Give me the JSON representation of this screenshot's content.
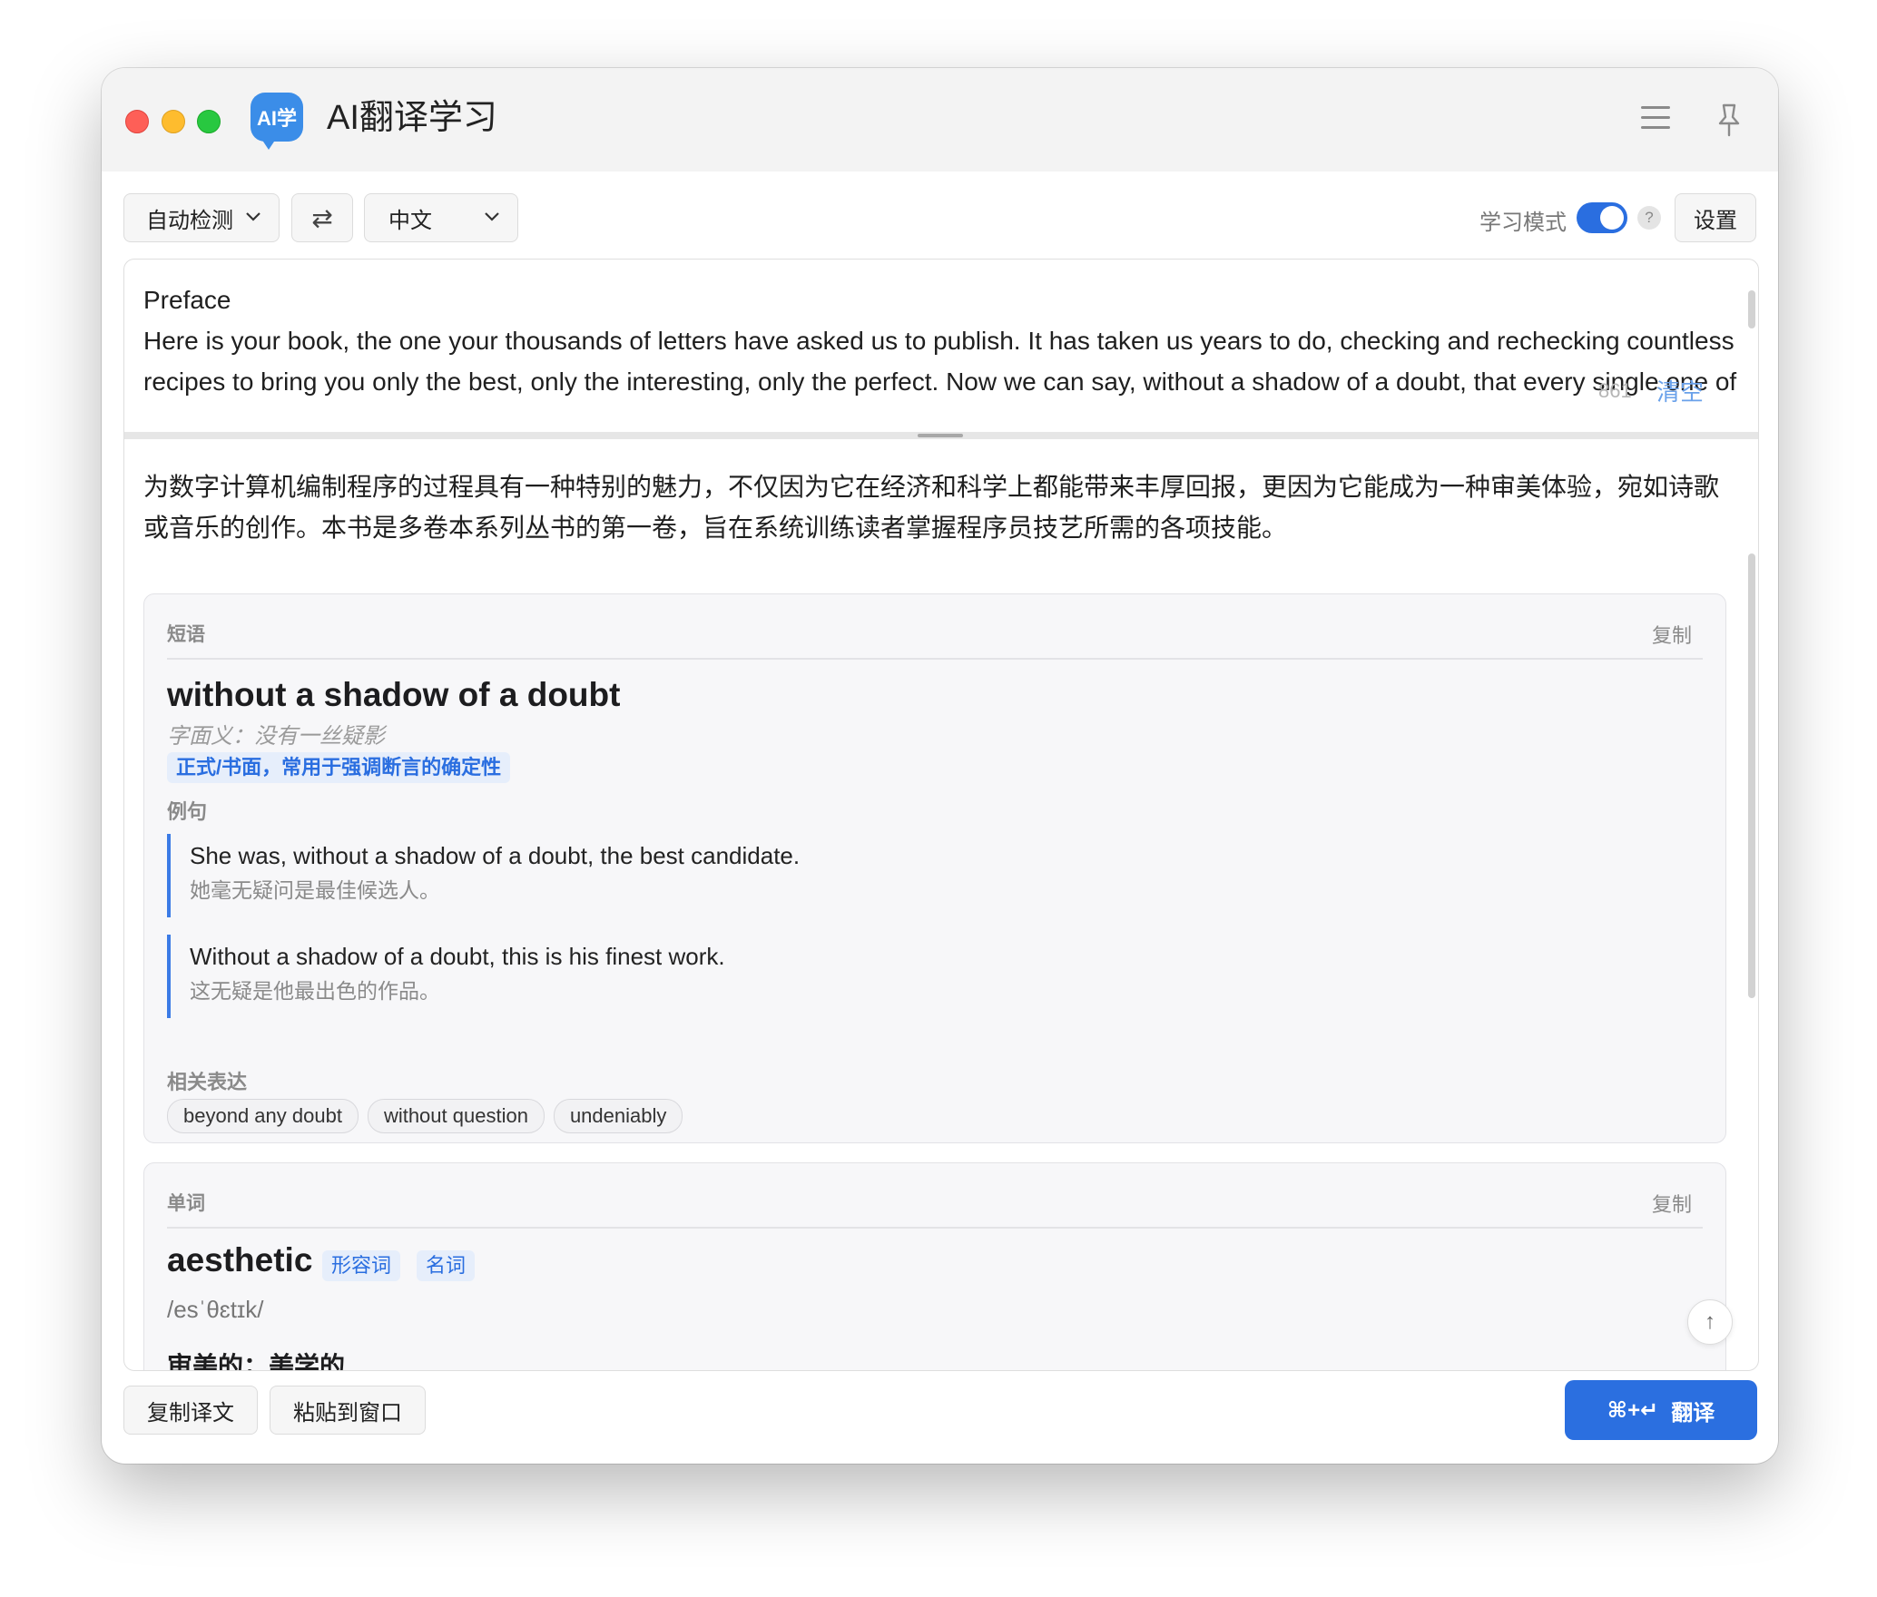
{
  "app": {
    "title": "AI翻译学习",
    "logo_text": "AI学",
    "accent_color": "#2b6fe0"
  },
  "toolbar": {
    "source_lang": "自动检测",
    "swap_symbol": "⇄",
    "target_lang": "中文",
    "learning_mode_label": "学习模式",
    "learning_mode_on": true,
    "help_symbol": "?",
    "settings_label": "设置"
  },
  "source": {
    "text": "Preface\nHere is your book, the one your thousands of letters have asked us to publish. It has taken us years to do, checking and rechecking countless recipes to bring you only the best, only the interesting, only the perfect. Now we can say, without a shadow of a doubt, that every single one of them, if you follow the directions to the letter, will work for you exactly as well as it did for us, even if you have never",
    "char_count": "861",
    "clear_label": "清空"
  },
  "translation": {
    "text": "为数字计算机编制程序的过程具有一种特别的魅力，不仅因为它在经济和科学上都能带来丰厚回报，更因为它能成为一种审美体验，宛如诗歌或音乐的创作。本书是多卷本系列丛书的第一卷，旨在系统训练读者掌握程序员技艺所需的各项技能。"
  },
  "phrase_card": {
    "type_label": "短语",
    "copy_label": "复制",
    "phrase": "without a shadow of a doubt",
    "literal": "字面义：没有一丝疑影",
    "usage_tag": "正式/书面，常用于强调断言的确定性",
    "examples_label": "例句",
    "examples": [
      {
        "en": "She was, without a shadow of a doubt, the best candidate.",
        "zh": "她毫无疑问是最佳候选人。"
      },
      {
        "en": "Without a shadow of a doubt, this is his finest work.",
        "zh": "这无疑是他最出色的作品。"
      }
    ],
    "related_label": "相关表达",
    "related": [
      "beyond any doubt",
      "without question",
      "undeniably"
    ]
  },
  "word_card": {
    "type_label": "单词",
    "copy_label": "复制",
    "word": "aesthetic",
    "pos": [
      "形容词",
      "名词"
    ],
    "phonetic": "/esˈθɛtɪk/",
    "meaning": "审美的；美学的"
  },
  "back_to_top_symbol": "↑",
  "bottom": {
    "copy_translation": "复制译文",
    "paste_to_window": "粘贴到窗口",
    "shortcut": "⌘+↵",
    "translate_label": "翻译"
  }
}
